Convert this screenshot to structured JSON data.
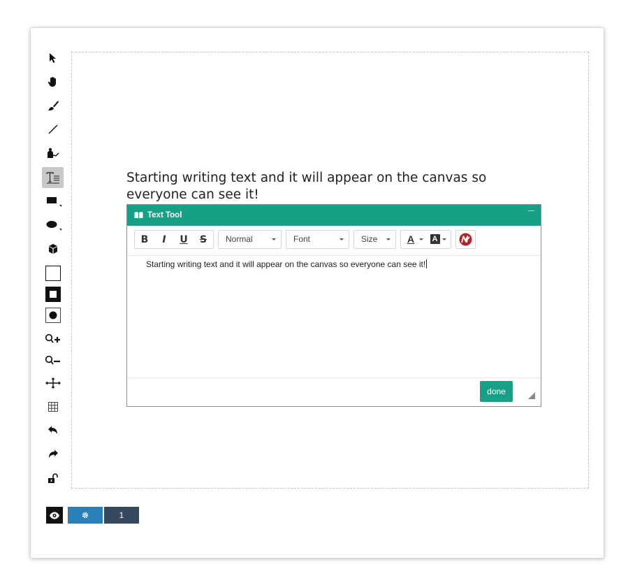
{
  "canvas": {
    "text": "Starting writing text and it will appear on the canvas so everyone can see it!"
  },
  "toolbar": {
    "tools": [
      {
        "id": "select",
        "icon": "pointer-icon"
      },
      {
        "id": "pan",
        "icon": "hand-icon"
      },
      {
        "id": "brush",
        "icon": "brush-icon"
      },
      {
        "id": "line",
        "icon": "line-icon"
      },
      {
        "id": "presenter",
        "icon": "presenter-icon"
      },
      {
        "id": "text",
        "icon": "text-icon",
        "active": true
      },
      {
        "id": "rectangle",
        "icon": "rectangle-icon"
      },
      {
        "id": "ellipse",
        "icon": "ellipse-icon"
      },
      {
        "id": "cube",
        "icon": "cube-icon"
      },
      {
        "id": "outline",
        "icon": "outline-square-icon"
      },
      {
        "id": "fill",
        "icon": "filled-square-icon"
      },
      {
        "id": "stroke",
        "icon": "stroke-circle-icon"
      },
      {
        "id": "zoom-in",
        "icon": "zoom-in-icon"
      },
      {
        "id": "zoom-out",
        "icon": "zoom-out-icon"
      },
      {
        "id": "move",
        "icon": "move-icon"
      },
      {
        "id": "grid",
        "icon": "grid-icon"
      },
      {
        "id": "undo",
        "icon": "undo-icon"
      },
      {
        "id": "redo",
        "icon": "redo-icon"
      },
      {
        "id": "lock",
        "icon": "unlock-icon"
      }
    ]
  },
  "text_tool": {
    "title": "Text Tool",
    "bold_label": "B",
    "italic_label": "I",
    "underline_label": "U",
    "strike_label": "S",
    "paragraph_value": "Normal",
    "font_value": "Font",
    "size_value": "Size",
    "font_color_label": "A",
    "highlight_label": "A",
    "content": "Starting writing text and it will appear on the canvas so everyone can see it!",
    "done_label": "done"
  },
  "footer": {
    "page_number": "1"
  },
  "colors": {
    "accent": "#16a085",
    "gear_button": "#2a80b9",
    "page_button": "#34495e",
    "math_icon": "#b0262b"
  }
}
